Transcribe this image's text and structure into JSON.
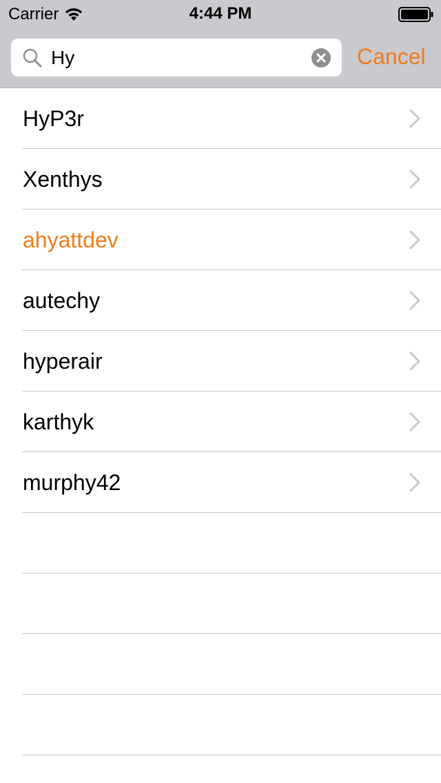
{
  "status_bar": {
    "carrier": "Carrier",
    "time": "4:44 PM"
  },
  "search": {
    "value": "Hy",
    "placeholder": "Search"
  },
  "cancel_label": "Cancel",
  "accent_color": "#f07c1c",
  "results": [
    {
      "label": "HyP3r",
      "selected": false
    },
    {
      "label": "Xenthys",
      "selected": false
    },
    {
      "label": "ahyattdev",
      "selected": true
    },
    {
      "label": "autechy",
      "selected": false
    },
    {
      "label": "hyperair",
      "selected": false
    },
    {
      "label": "karthyk",
      "selected": false
    },
    {
      "label": "murphy42",
      "selected": false
    }
  ],
  "empty_rows": 4,
  "icons": {
    "search": "search-icon",
    "clear": "clear-icon",
    "chevron": "chevron-right-icon",
    "wifi": "wifi-icon",
    "battery": "battery-icon"
  }
}
